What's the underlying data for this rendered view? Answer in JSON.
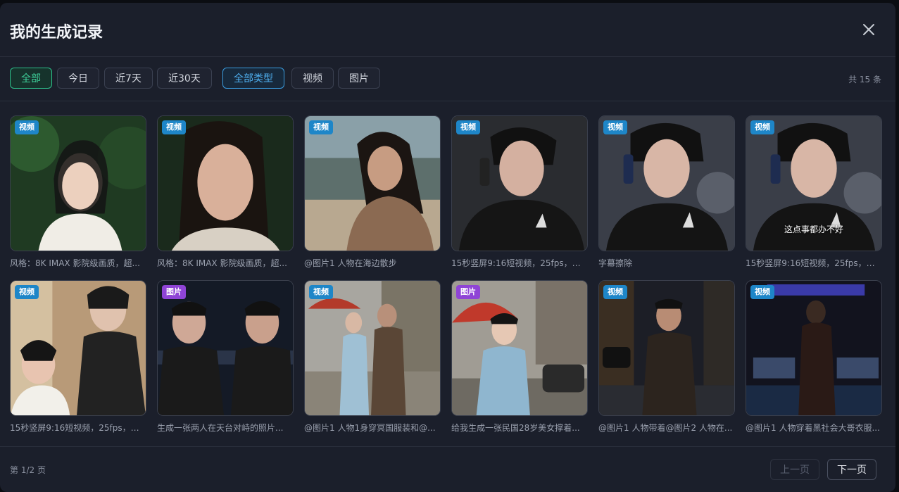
{
  "dialog": {
    "title": "我的生成记录",
    "close_icon": "close-icon"
  },
  "filters": {
    "time": [
      {
        "label": "全部",
        "active": true
      },
      {
        "label": "今日",
        "active": false
      },
      {
        "label": "近7天",
        "active": false
      },
      {
        "label": "近30天",
        "active": false
      }
    ],
    "type": [
      {
        "label": "全部类型",
        "active": true
      },
      {
        "label": "视频",
        "active": false
      },
      {
        "label": "图片",
        "active": false
      }
    ],
    "total": "共 15 条"
  },
  "records": [
    {
      "kind": "video",
      "badge": "视频",
      "caption": "风格：8K IMAX 影院级画质，超..."
    },
    {
      "kind": "video",
      "badge": "视频",
      "caption": "风格：8K IMAX 影院级画质，超..."
    },
    {
      "kind": "video",
      "badge": "视频",
      "caption": "@图片1 人物在海边散步"
    },
    {
      "kind": "video",
      "badge": "视频",
      "caption": "15秒竖屏9:16短视频，25fps，画..."
    },
    {
      "kind": "video",
      "badge": "视频",
      "caption": "字幕擦除"
    },
    {
      "kind": "video",
      "badge": "视频",
      "caption": "15秒竖屏9:16短视频，25fps，画...",
      "subtitle": "这点事都办不好"
    },
    {
      "kind": "video",
      "badge": "视频",
      "caption": "15秒竖屏9:16短视频，25fps，画..."
    },
    {
      "kind": "image",
      "badge": "图片",
      "caption": "生成一张两人在天台对峙的照片..."
    },
    {
      "kind": "video",
      "badge": "视频",
      "caption": "@图片1 人物1身穿冥国服装和@..."
    },
    {
      "kind": "image",
      "badge": "图片",
      "caption": "给我生成一张民国28岁美女撑着..."
    },
    {
      "kind": "video",
      "badge": "视频",
      "caption": "@图片1 人物带着@图片2 人物在..."
    },
    {
      "kind": "video",
      "badge": "视频",
      "caption": "@图片1 人物穿着黑社会大哥衣服..."
    }
  ],
  "pagination": {
    "info": "第 1/2 页",
    "prev": "上一页",
    "next": "下一页"
  },
  "colors": {
    "active_time": "#3fd29b",
    "active_type": "#4fb0f0",
    "video_badge": "#1e86c8",
    "image_badge": "#8f44d6"
  }
}
